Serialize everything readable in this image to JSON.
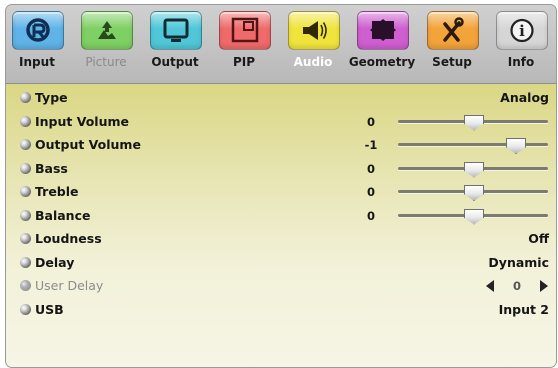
{
  "tabs": [
    {
      "label": "Input",
      "icon": "input-r-icon",
      "color": "#5fb3e8",
      "state": "normal"
    },
    {
      "label": "Picture",
      "icon": "picture-icon",
      "color": "#7fd064",
      "state": "disabled"
    },
    {
      "label": "Output",
      "icon": "output-monitor-icon",
      "color": "#4fc7d8",
      "state": "normal"
    },
    {
      "label": "PIP",
      "icon": "pip-icon",
      "color": "#f06a6a",
      "state": "normal"
    },
    {
      "label": "Audio",
      "icon": "speaker-icon",
      "color": "#f0e43c",
      "state": "active"
    },
    {
      "label": "Geometry",
      "icon": "geometry-icon",
      "color": "#cf5ed0",
      "state": "normal"
    },
    {
      "label": "Setup",
      "icon": "tools-icon",
      "color": "#f2a33a",
      "state": "normal"
    },
    {
      "label": "Info",
      "icon": "info-icon",
      "color": "#d6d6d6",
      "state": "normal"
    }
  ],
  "menu": [
    {
      "label": "Type",
      "kind": "value",
      "value": "Analog",
      "enabled": true
    },
    {
      "label": "Input Volume",
      "kind": "slider",
      "value": "0",
      "level": 0.5,
      "enabled": true
    },
    {
      "label": "Output Volume",
      "kind": "slider",
      "value": "-1",
      "level": 0.78,
      "enabled": true
    },
    {
      "label": "Bass",
      "kind": "slider",
      "value": "0",
      "level": 0.5,
      "enabled": true
    },
    {
      "label": "Treble",
      "kind": "slider",
      "value": "0",
      "level": 0.5,
      "enabled": true
    },
    {
      "label": "Balance",
      "kind": "slider",
      "value": "0",
      "level": 0.5,
      "enabled": true
    },
    {
      "label": "Loudness",
      "kind": "value",
      "value": "Off",
      "enabled": true
    },
    {
      "label": "Delay",
      "kind": "value",
      "value": "Dynamic",
      "enabled": true
    },
    {
      "label": "User Delay",
      "kind": "spinner",
      "value": "0",
      "enabled": false
    },
    {
      "label": "USB",
      "kind": "value",
      "value": "Input 2",
      "enabled": true
    }
  ]
}
